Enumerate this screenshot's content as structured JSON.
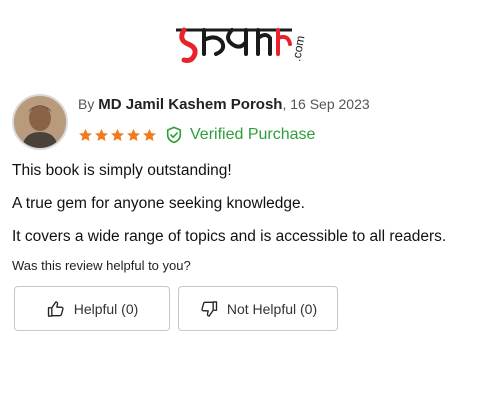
{
  "brand": {
    "logo_text": "রকমারি",
    "logo_suffix": ".com",
    "logo_color": "#e8212b",
    "logo_text_color": "#1a1a1a"
  },
  "review": {
    "by_prefix": "By",
    "author": "MD Jamil Kashem Porosh",
    "date": "16 Sep 2023",
    "rating": 5,
    "rating_max": 5,
    "star_color": "#f47b20",
    "verified_label": "Verified Purchase",
    "verified_color": "#2e9e39",
    "avatar_icon": "user-photo",
    "body": [
      "This book is simply outstanding!",
      "A true gem for anyone seeking knowledge.",
      "It covers a wide range of topics and is accessible to all readers."
    ]
  },
  "feedback": {
    "question": "Was this review helpful to you?",
    "helpful_label": "Helpful (0)",
    "not_helpful_label": "Not Helpful (0)",
    "helpful_icon": "thumbs-up-icon",
    "not_helpful_icon": "thumbs-down-icon"
  }
}
